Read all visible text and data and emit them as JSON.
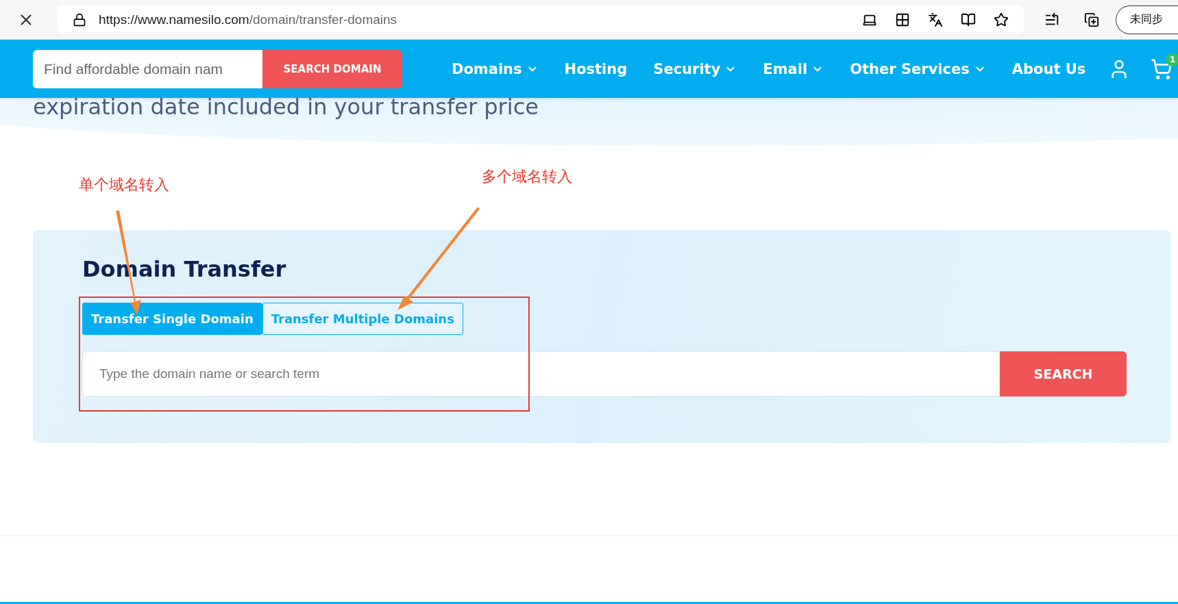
{
  "browser": {
    "url_host": "https://www.namesilo.com",
    "url_path": "/domain/transfer-domains",
    "profile": "未同步"
  },
  "nav": {
    "search_placeholder": "Find affordable domain nam",
    "search_button": "SEARCH DOMAIN",
    "items": [
      {
        "label": "Domains",
        "dropdown": true
      },
      {
        "label": "Hosting",
        "dropdown": false
      },
      {
        "label": "Security",
        "dropdown": true
      },
      {
        "label": "Email",
        "dropdown": true
      },
      {
        "label": "Other Services",
        "dropdown": true
      },
      {
        "label": "About Us",
        "dropdown": false
      }
    ],
    "cart_count": "1"
  },
  "intro": "expiration date included in your transfer price",
  "transfer": {
    "title": "Domain Transfer",
    "tabs": [
      {
        "label": "Transfer Single Domain",
        "selected": true
      },
      {
        "label": "Transfer Multiple Domains",
        "selected": false
      }
    ],
    "placeholder": "Type the domain name or search term",
    "button": "SEARCH"
  },
  "annotations": [
    {
      "text": "单个域名转入"
    },
    {
      "text": "多个域名转入"
    }
  ]
}
